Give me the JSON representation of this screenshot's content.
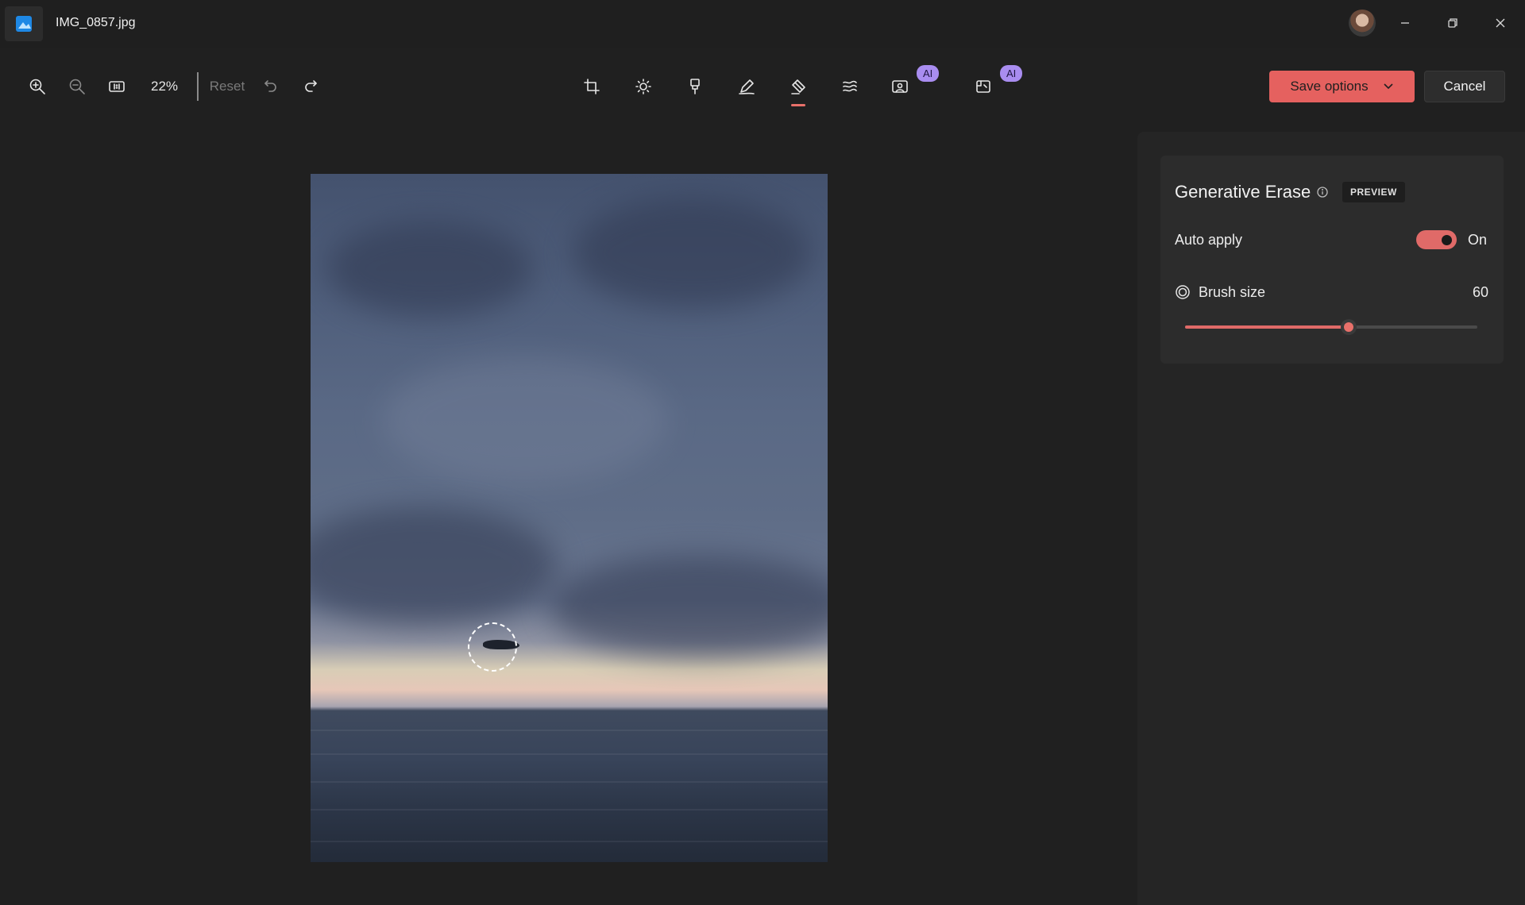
{
  "window": {
    "file_name": "IMG_0857.jpg"
  },
  "toolbar": {
    "zoom": "22%",
    "reset_label": "Reset",
    "tools": [
      {
        "name": "crop-icon"
      },
      {
        "name": "brightness-icon"
      },
      {
        "name": "filter-icon"
      },
      {
        "name": "markup-icon"
      },
      {
        "name": "erase-icon",
        "active": true
      },
      {
        "name": "background-blur-icon"
      },
      {
        "name": "background-icon",
        "badge": "AI"
      },
      {
        "name": "restyle-icon",
        "badge": "AI"
      }
    ],
    "save_label": "Save options",
    "cancel_label": "Cancel",
    "accent": "#e5615f"
  },
  "panel": {
    "title": "Generative Erase",
    "badge": "PREVIEW",
    "auto_apply_label": "Auto apply",
    "auto_apply_state": "On",
    "auto_apply_on": true,
    "brush_label": "Brush size",
    "brush_value": "60",
    "brush_fraction": 0.56
  }
}
